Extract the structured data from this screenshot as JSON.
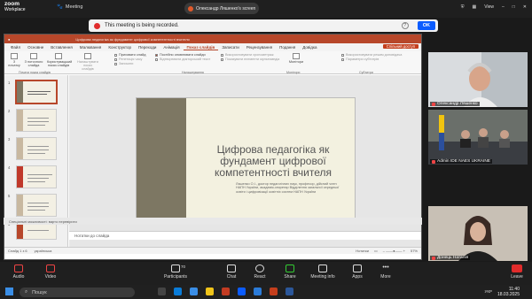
{
  "zoom": {
    "logo_line1": "zoom",
    "logo_line2": "Workplace",
    "meeting_label": "Meeting",
    "speaker": "Олександр Ляшенко's screen",
    "view_label": "View",
    "recording_text": "This meeting is being recorded.",
    "ok_label": "OK"
  },
  "ppt": {
    "title_bar": "Цифрова педагогіка як фундамент цифрової компетентності вчителя",
    "tabs": [
      "Файл",
      "Основне",
      "Вставлення",
      "Малювання",
      "Конструктор",
      "Переходи",
      "Анімація",
      "Показ слайдів",
      "Записати",
      "Рецензування",
      "Подання",
      "Довідка"
    ],
    "active_tab_index": 7,
    "share_label": "Спільний доступ",
    "ribbon": {
      "from_start": "З початку",
      "from_current": "З поточного слайда",
      "custom_show": "Користувацький показ слайдів",
      "setup": "Налаштувати показ слайдів",
      "hide_slide": "Приховати слайд",
      "rehearse": "Репетиція часу",
      "record": "Записати",
      "play_narrations": "Постійно оновлювати слайди",
      "use_timings": "Відтворювати дикторський текст",
      "show_media": "Використовувати хронометраж",
      "show_controls": "Показувати елементи мультимедіа",
      "monitor": "Монітори",
      "use_presenter": "Використовувати режим доповідача",
      "always_subtitles": "Завжди використовувати субтитри",
      "subtitle_settings": "Параметри субтитрів",
      "group_start": "Почати показ слайдів",
      "group_setup": "Налаштування",
      "group_monitors": "Монітори",
      "group_subtitles": "Субтитри"
    },
    "slide_numbers": [
      "1",
      "2",
      "3",
      "4",
      "5",
      "6"
    ],
    "slide": {
      "title": "Цифрова педагогіка як фундамент цифрової компетентності вчителя",
      "subtitle": "Ляшенко О.І., доктор педагогічних наук, професор, дійсний член НАПН України, академік-секретар Відділення загальної середньої освіти і цифровізації освітніх систем НАПН України"
    },
    "notes_placeholder": "Нотатки до слайда",
    "status_slide": "Слайд 1 з 6",
    "status_lang": "українська",
    "status_notes": "Нотатки",
    "status_zoom": "57%",
    "accessibility": "Спеціальні можливості: варто перевірити"
  },
  "participants": [
    {
      "name": "Олександр Ляшенко"
    },
    {
      "name": "Admin IDE NAES UKRAINE"
    },
    {
      "name": "Донець Наталія"
    }
  ],
  "controls": {
    "audio": "Audio",
    "video": "Video",
    "participants": "Participants",
    "participants_count": "70",
    "chat": "Chat",
    "react": "React",
    "share": "Share",
    "meeting_info": "Meeting info",
    "apps": "Apps",
    "more": "More",
    "leave": "Leave"
  },
  "taskbar": {
    "search": "Пошук",
    "lang": "УКР",
    "time": "11:40",
    "date": "18.03.2025"
  }
}
